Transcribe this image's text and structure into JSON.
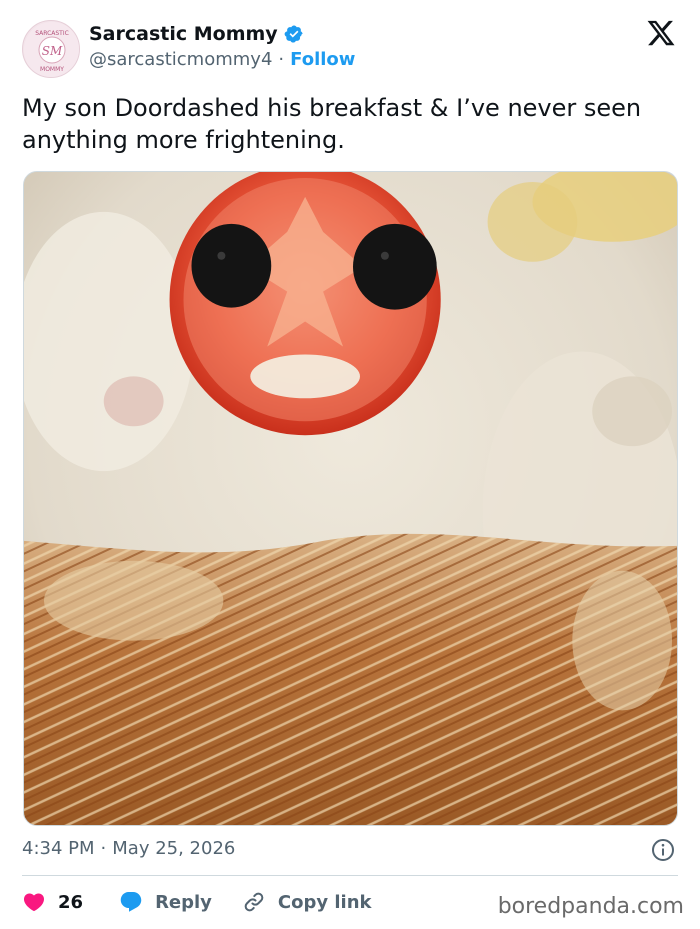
{
  "author": {
    "display_name": "Sarcastic Mommy",
    "handle": "@sarcasticmommy4",
    "separator": "·",
    "follow_label": "Follow",
    "avatar_text_top": "SARCASTIC",
    "avatar_initials": "SM",
    "avatar_text_bottom": "MOMMY"
  },
  "tweet": {
    "text": "My son Doordashed his breakfast & I’ve never seen anything more frightening.",
    "time": "4:34 PM",
    "separator": "·",
    "date": "May 25, 2026"
  },
  "actions": {
    "like_count": "26",
    "reply_label": "Reply",
    "copy_link_label": "Copy link"
  },
  "watermark": "boredpanda.com",
  "icons": {
    "verified": "verified-badge-icon",
    "x_logo": "x-logo-icon",
    "info": "info-icon",
    "heart": "heart-icon",
    "reply": "reply-bubble-icon",
    "link": "link-icon"
  },
  "colors": {
    "accent": "#1d9bf0",
    "like": "#f91880",
    "text": "#0f1419",
    "muted": "#536471"
  }
}
